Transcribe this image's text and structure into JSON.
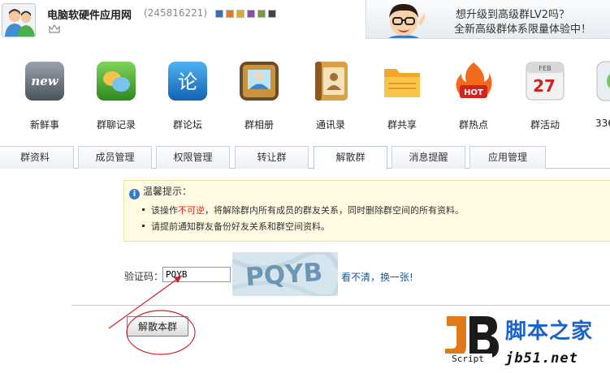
{
  "header": {
    "group_name": "电脑软硬件应用网",
    "group_id": "(245816221)",
    "skin_colors": [
      "#3a6fb0",
      "#e07b25",
      "#e0a92a",
      "#8a4fa0",
      "#7a9a3a",
      "#444444"
    ]
  },
  "banner": {
    "line1": "想升级到高级群LV2吗？",
    "line2": "全新高级群体系限量体验中！"
  },
  "apps": [
    {
      "label": "新鲜事",
      "icon": "news-icon"
    },
    {
      "label": "群聊记录",
      "icon": "chat-bubbles-icon"
    },
    {
      "label": "群论坛",
      "icon": "forum-icon"
    },
    {
      "label": "群相册",
      "icon": "photo-album-icon"
    },
    {
      "label": "通讯录",
      "icon": "address-book-icon"
    },
    {
      "label": "群共享",
      "icon": "shared-folder-icon"
    },
    {
      "label": "群热点",
      "icon": "hot-topics-icon"
    },
    {
      "label": "群活动",
      "icon": "calendar-icon"
    },
    {
      "label": "336",
      "icon": "app-icon"
    }
  ],
  "calendar_icon": {
    "month": "FEB",
    "day": "27"
  },
  "tabs": [
    "群资料",
    "成员管理",
    "权限管理",
    "转让群",
    "解散群",
    "消息提醒",
    "应用管理"
  ],
  "active_tab": "解散群",
  "notice": {
    "title": "温馨提示：",
    "line1_pre": "该操作",
    "line1_warn": "不可逆",
    "line1_post": "，将解除群内所有成员的群友关系，同时删除群空间的所有资料。",
    "line2": "请提前通知群友备份好友关系和群空间资料。"
  },
  "captcha": {
    "label": "验证码：",
    "value": "PQYB",
    "image_text": "PQYB",
    "refresh_link": "看不清，换一张!"
  },
  "dissolve_button": "解散本群",
  "watermark": {
    "logo_script": "Script",
    "site_name": "脚本之家",
    "url": "jb51.net"
  }
}
